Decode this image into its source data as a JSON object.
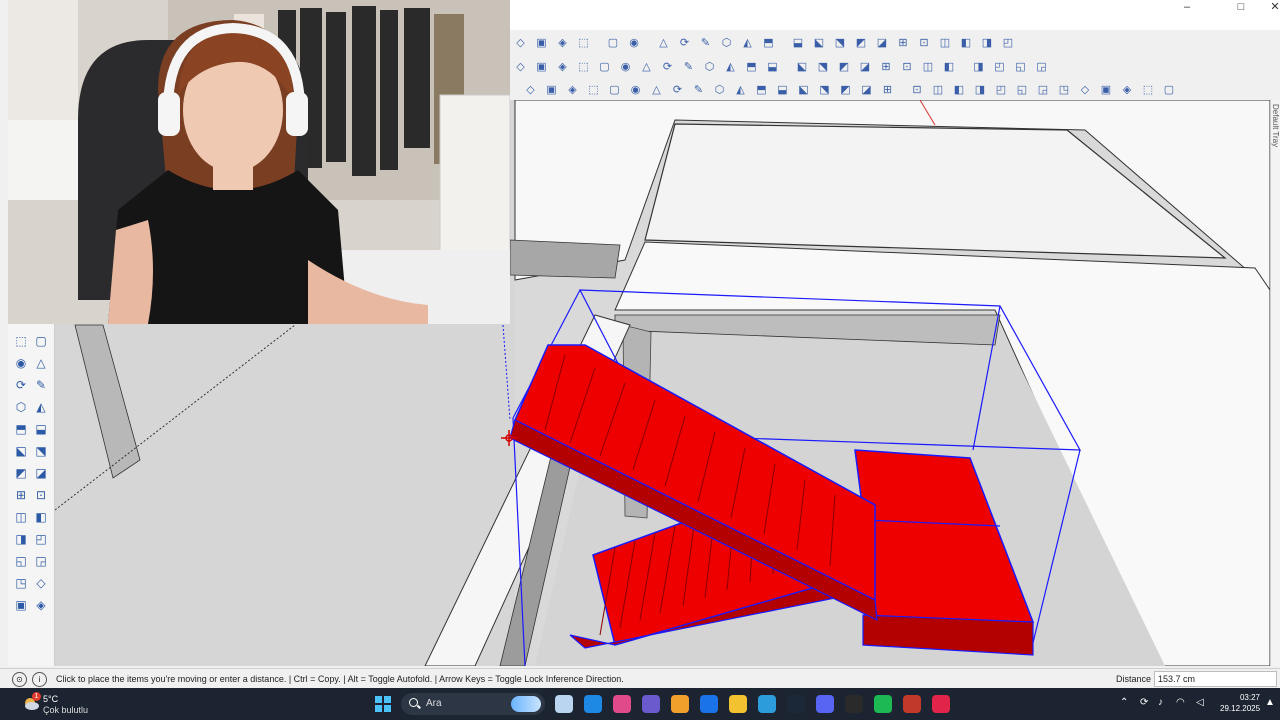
{
  "window": {
    "minimize_glyph": "–",
    "maximize_glyph": "□",
    "colors": {
      "stair_fill": "#ee0000",
      "selection": "#1a1aff",
      "model_floor": "#f7f7f7",
      "viewport_bg": "#d9d9d9"
    }
  },
  "toolbars": {
    "row1_icons": [
      "select-icon",
      "component-icon",
      "paint-icon",
      "eraser-icon",
      "new-file-icon",
      "user-icon",
      "section-icon",
      "section-fill-icon",
      "section-display-icon",
      "warehouse-icon",
      "extension-icon",
      "iso-view-icon",
      "top-view-icon",
      "front-view-icon",
      "right-view-icon",
      "back-view-icon",
      "left-view-icon",
      "xray-icon",
      "wireframe-icon",
      "hidden-line-icon",
      "shaded-icon",
      "textured-icon",
      "monochrome-icon"
    ],
    "row2_icons": [
      "warning-icon",
      "lasso-icon",
      "rotate-icon",
      "orbit-icon",
      "move-icon",
      "paint-bucket-icon",
      "undo-icon",
      "push-pull-icon",
      "offset-icon",
      "tape-icon",
      "protractor-icon",
      "dimension-icon",
      "axes-icon",
      "walk-icon",
      "look-icon",
      "solar-icon",
      "grid-icon",
      "grid-fill-icon",
      "circle-icon",
      "arc-icon",
      "freehand-icon",
      "scale-icon",
      "flip-icon",
      "mirror-icon",
      "measure-icon"
    ],
    "row3_icons": [
      "line-tool-icon",
      "arc-tool-icon",
      "curve-icon",
      "spline-icon",
      "bezier-icon",
      "rectangle-icon",
      "circle-tool-icon",
      "polygon-icon",
      "pie-icon",
      "curviloft-icon",
      "pencil-icon",
      "freehand-tool-icon",
      "arc-2pt-icon",
      "arc-3pt-icon",
      "wave-icon",
      "paint-tool-icon",
      "ellipse-icon",
      "eraser-tool-icon",
      "extrude-icon",
      "sandbox-icon",
      "smoove-icon",
      "stamp-icon",
      "drape-icon",
      "flip-edge-icon",
      "add-detail-icon",
      "contour-icon",
      "mesh-icon",
      "terrain-icon",
      "box-icon",
      "layer-icon",
      "scene-icon"
    ]
  },
  "tray": {
    "label": "Default Tray"
  },
  "left_tools": [
    "select-left-icon",
    "eraser-left-icon",
    "rectangle-left-icon",
    "push-left-icon",
    "move-left-icon",
    "rotate-left-icon",
    "scale-left-icon",
    "offset-left-icon",
    "tape-left-icon",
    "text-left-icon",
    "dim-left-icon",
    "protractor-left-icon",
    "axes-left-icon",
    "3dtext-left-icon",
    "orbit-left-icon",
    "pan-left-icon",
    "zoom-left-icon",
    "zoom-window-left-icon",
    "zoom-extents-left-icon",
    "previous-left-icon",
    "walk-left-icon",
    "look-left-icon",
    "position-camera-left-icon",
    "section-left-icon",
    "layers-left-icon",
    "scenes-left-icon"
  ],
  "status": {
    "message": "Click to place the items you're moving or enter a distance. | Ctrl = Copy. | Alt = Toggle Autofold. | Arrow Keys = Toggle Lock Inference Direction.",
    "distance_label": "Distance",
    "distance_value": "153.7 cm"
  },
  "taskbar": {
    "temperature": "5°C",
    "weather": "Çok bulutlu",
    "weather_badge": "1",
    "search_placeholder": "Ara",
    "apps": [
      "file-explorer-icon",
      "edge-icon",
      "store-icon",
      "teams-icon",
      "copilot-icon",
      "outlook-icon",
      "folder-icon",
      "vscode-icon",
      "steam-icon",
      "discord-icon",
      "github-icon",
      "spotify-icon",
      "sketchup-icon",
      "acrobat-icon"
    ],
    "time": "03:27",
    "date": "29.12.2025"
  }
}
